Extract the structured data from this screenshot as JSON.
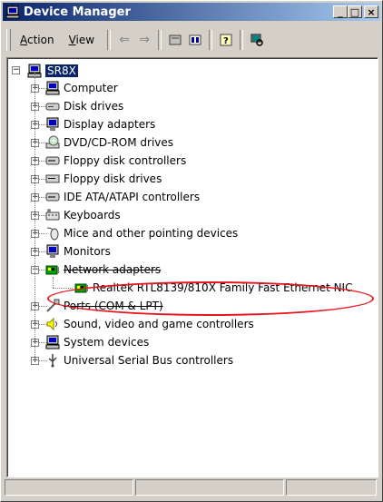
{
  "window": {
    "title": "Device Manager"
  },
  "titlebar_buttons": {
    "minimize": "_",
    "maximize": "□",
    "close": "×"
  },
  "menu": [
    {
      "label": "Action",
      "accel": "A"
    },
    {
      "label": "View",
      "accel": "V"
    }
  ],
  "toolbar_icons": [
    "back-arrow-icon",
    "forward-arrow-icon",
    "properties-icon",
    "tree-view-icon",
    "help-icon",
    "scan-hardware-icon"
  ],
  "tree": {
    "root": "SR8X",
    "items": [
      {
        "label": "Computer",
        "icon": "computer-icon",
        "expanded": false
      },
      {
        "label": "Disk drives",
        "icon": "disk-drive-icon",
        "expanded": false
      },
      {
        "label": "Display adapters",
        "icon": "monitor-icon",
        "expanded": false
      },
      {
        "label": "DVD/CD-ROM drives",
        "icon": "cdrom-icon",
        "expanded": false
      },
      {
        "label": "Floppy disk controllers",
        "icon": "controller-icon",
        "expanded": false
      },
      {
        "label": "Floppy disk drives",
        "icon": "floppy-drive-icon",
        "expanded": false
      },
      {
        "label": "IDE ATA/ATAPI controllers",
        "icon": "controller-icon",
        "expanded": false
      },
      {
        "label": "Keyboards",
        "icon": "keyboard-icon",
        "expanded": false
      },
      {
        "label": "Mice and other pointing devices",
        "icon": "mouse-icon",
        "expanded": false
      },
      {
        "label": "Monitors",
        "icon": "monitor-icon",
        "expanded": false
      },
      {
        "label": "Network adapters",
        "icon": "network-card-icon",
        "expanded": true,
        "children": [
          {
            "label": "Realtek RTL8139/810X Family Fast Ethernet NIC",
            "icon": "network-card-icon"
          }
        ]
      },
      {
        "label": "Ports (COM & LPT)",
        "icon": "port-icon",
        "expanded": false
      },
      {
        "label": "Sound, video and game controllers",
        "icon": "sound-icon",
        "expanded": false
      },
      {
        "label": "System devices",
        "icon": "computer-icon",
        "expanded": false
      },
      {
        "label": "Universal Serial Bus controllers",
        "icon": "usb-icon",
        "expanded": false
      }
    ]
  },
  "colors": {
    "title_start": "#0a246a",
    "title_end": "#a6caf0",
    "annotation": "#e8141e",
    "face": "#d4d0c8"
  }
}
